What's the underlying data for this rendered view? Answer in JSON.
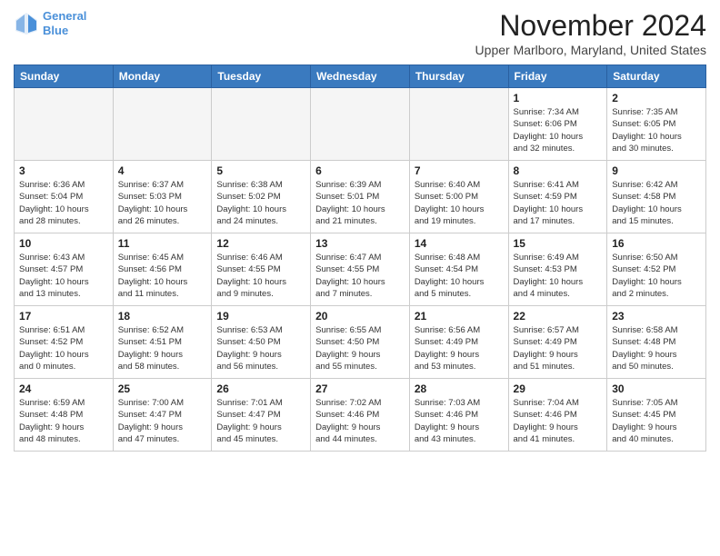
{
  "header": {
    "logo_line1": "General",
    "logo_line2": "Blue",
    "month": "November 2024",
    "location": "Upper Marlboro, Maryland, United States"
  },
  "days_of_week": [
    "Sunday",
    "Monday",
    "Tuesday",
    "Wednesday",
    "Thursday",
    "Friday",
    "Saturday"
  ],
  "weeks": [
    [
      {
        "day": null,
        "info": null
      },
      {
        "day": null,
        "info": null
      },
      {
        "day": null,
        "info": null
      },
      {
        "day": null,
        "info": null
      },
      {
        "day": null,
        "info": null
      },
      {
        "day": "1",
        "info": "Sunrise: 7:34 AM\nSunset: 6:06 PM\nDaylight: 10 hours\nand 32 minutes."
      },
      {
        "day": "2",
        "info": "Sunrise: 7:35 AM\nSunset: 6:05 PM\nDaylight: 10 hours\nand 30 minutes."
      }
    ],
    [
      {
        "day": "3",
        "info": "Sunrise: 6:36 AM\nSunset: 5:04 PM\nDaylight: 10 hours\nand 28 minutes."
      },
      {
        "day": "4",
        "info": "Sunrise: 6:37 AM\nSunset: 5:03 PM\nDaylight: 10 hours\nand 26 minutes."
      },
      {
        "day": "5",
        "info": "Sunrise: 6:38 AM\nSunset: 5:02 PM\nDaylight: 10 hours\nand 24 minutes."
      },
      {
        "day": "6",
        "info": "Sunrise: 6:39 AM\nSunset: 5:01 PM\nDaylight: 10 hours\nand 21 minutes."
      },
      {
        "day": "7",
        "info": "Sunrise: 6:40 AM\nSunset: 5:00 PM\nDaylight: 10 hours\nand 19 minutes."
      },
      {
        "day": "8",
        "info": "Sunrise: 6:41 AM\nSunset: 4:59 PM\nDaylight: 10 hours\nand 17 minutes."
      },
      {
        "day": "9",
        "info": "Sunrise: 6:42 AM\nSunset: 4:58 PM\nDaylight: 10 hours\nand 15 minutes."
      }
    ],
    [
      {
        "day": "10",
        "info": "Sunrise: 6:43 AM\nSunset: 4:57 PM\nDaylight: 10 hours\nand 13 minutes."
      },
      {
        "day": "11",
        "info": "Sunrise: 6:45 AM\nSunset: 4:56 PM\nDaylight: 10 hours\nand 11 minutes."
      },
      {
        "day": "12",
        "info": "Sunrise: 6:46 AM\nSunset: 4:55 PM\nDaylight: 10 hours\nand 9 minutes."
      },
      {
        "day": "13",
        "info": "Sunrise: 6:47 AM\nSunset: 4:55 PM\nDaylight: 10 hours\nand 7 minutes."
      },
      {
        "day": "14",
        "info": "Sunrise: 6:48 AM\nSunset: 4:54 PM\nDaylight: 10 hours\nand 5 minutes."
      },
      {
        "day": "15",
        "info": "Sunrise: 6:49 AM\nSunset: 4:53 PM\nDaylight: 10 hours\nand 4 minutes."
      },
      {
        "day": "16",
        "info": "Sunrise: 6:50 AM\nSunset: 4:52 PM\nDaylight: 10 hours\nand 2 minutes."
      }
    ],
    [
      {
        "day": "17",
        "info": "Sunrise: 6:51 AM\nSunset: 4:52 PM\nDaylight: 10 hours\nand 0 minutes."
      },
      {
        "day": "18",
        "info": "Sunrise: 6:52 AM\nSunset: 4:51 PM\nDaylight: 9 hours\nand 58 minutes."
      },
      {
        "day": "19",
        "info": "Sunrise: 6:53 AM\nSunset: 4:50 PM\nDaylight: 9 hours\nand 56 minutes."
      },
      {
        "day": "20",
        "info": "Sunrise: 6:55 AM\nSunset: 4:50 PM\nDaylight: 9 hours\nand 55 minutes."
      },
      {
        "day": "21",
        "info": "Sunrise: 6:56 AM\nSunset: 4:49 PM\nDaylight: 9 hours\nand 53 minutes."
      },
      {
        "day": "22",
        "info": "Sunrise: 6:57 AM\nSunset: 4:49 PM\nDaylight: 9 hours\nand 51 minutes."
      },
      {
        "day": "23",
        "info": "Sunrise: 6:58 AM\nSunset: 4:48 PM\nDaylight: 9 hours\nand 50 minutes."
      }
    ],
    [
      {
        "day": "24",
        "info": "Sunrise: 6:59 AM\nSunset: 4:48 PM\nDaylight: 9 hours\nand 48 minutes."
      },
      {
        "day": "25",
        "info": "Sunrise: 7:00 AM\nSunset: 4:47 PM\nDaylight: 9 hours\nand 47 minutes."
      },
      {
        "day": "26",
        "info": "Sunrise: 7:01 AM\nSunset: 4:47 PM\nDaylight: 9 hours\nand 45 minutes."
      },
      {
        "day": "27",
        "info": "Sunrise: 7:02 AM\nSunset: 4:46 PM\nDaylight: 9 hours\nand 44 minutes."
      },
      {
        "day": "28",
        "info": "Sunrise: 7:03 AM\nSunset: 4:46 PM\nDaylight: 9 hours\nand 43 minutes."
      },
      {
        "day": "29",
        "info": "Sunrise: 7:04 AM\nSunset: 4:46 PM\nDaylight: 9 hours\nand 41 minutes."
      },
      {
        "day": "30",
        "info": "Sunrise: 7:05 AM\nSunset: 4:45 PM\nDaylight: 9 hours\nand 40 minutes."
      }
    ]
  ]
}
